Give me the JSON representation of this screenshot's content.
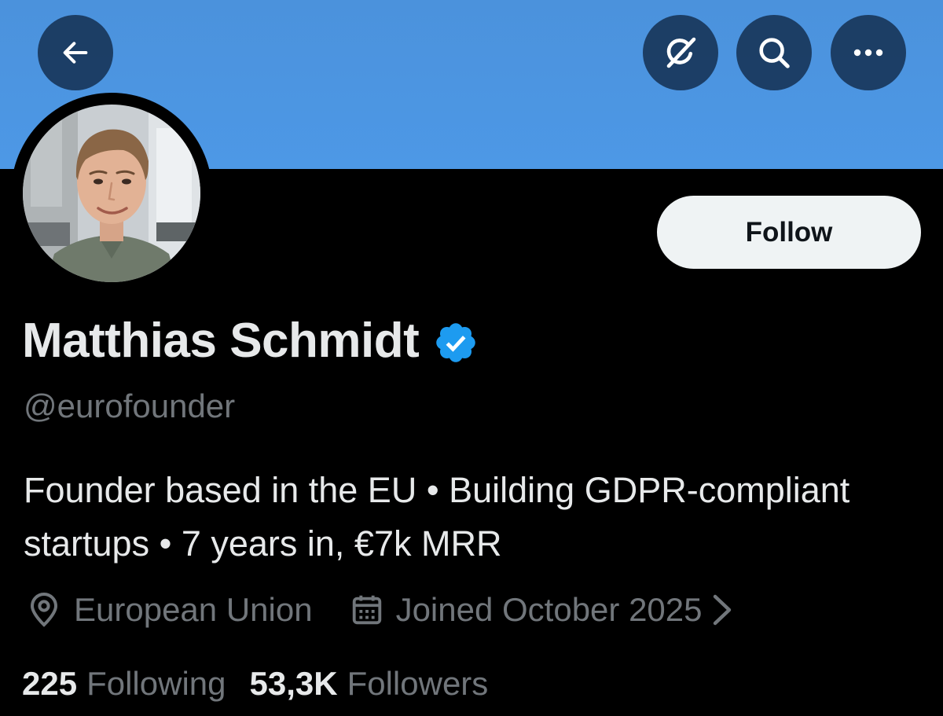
{
  "header": {
    "back_icon": "arrow-left-icon",
    "grok_icon": "grok-icon",
    "search_icon": "search-icon",
    "more_icon": "more-horizontal-icon",
    "banner_color": "#4d97e4"
  },
  "profile": {
    "avatar_icon": "profile-photo",
    "follow_label": "Follow",
    "display_name": "Matthias Schmidt",
    "verified_icon": "verified-badge-icon",
    "verified_color": "#1d9bf0",
    "handle": "@eurofounder",
    "bio": "Founder based in the EU • Building GDPR-compliant startups • 7 years in, €7k MRR",
    "location_icon": "location-pin-icon",
    "location": "European Union",
    "joined_icon": "calendar-icon",
    "joined": "Joined October 2025",
    "joined_chevron_icon": "chevron-right-icon"
  },
  "stats": {
    "following_count": "225",
    "following_label": "Following",
    "followers_count": "53,3K",
    "followers_label": "Followers"
  }
}
